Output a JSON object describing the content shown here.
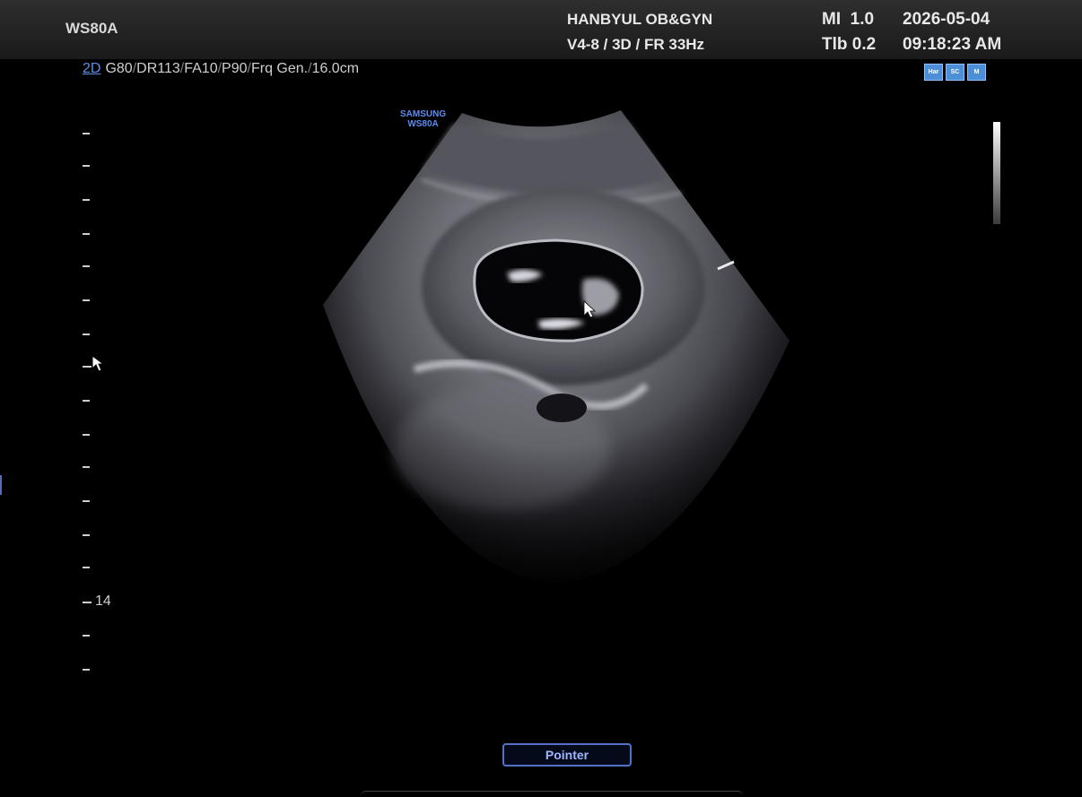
{
  "header": {
    "model": "WS80A",
    "hospital": "HANBYUL OB&GYN",
    "probe_info": "V4-8 / 3D / FR 33Hz",
    "mi": "MI  1.0",
    "tib": "Tlb 0.2",
    "date": "2026-05-04",
    "time": "09:18:23 AM"
  },
  "imaging": {
    "mode": "2D",
    "params": [
      "G80",
      "DR113",
      "FA10",
      "P90",
      "Frq Gen.",
      "16.0cm"
    ]
  },
  "status_icons": [
    "Har",
    "SC",
    "M"
  ],
  "brand": {
    "line1": "SAMSUNG",
    "line2": "WS80A"
  },
  "depth_scale": {
    "label": "14"
  },
  "footer": {
    "pointer_label": "Pointer"
  },
  "colors": {
    "accent": "#5a8ee8",
    "button_border": "#5570c8"
  }
}
